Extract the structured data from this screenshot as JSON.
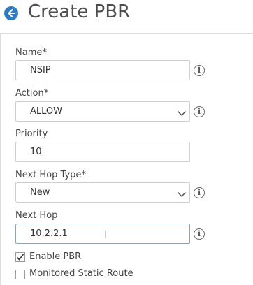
{
  "header": {
    "title": "Create PBR"
  },
  "form": {
    "name": {
      "label": "Name*",
      "value": "NSIP"
    },
    "action": {
      "label": "Action*",
      "value": "ALLOW"
    },
    "priority": {
      "label": "Priority",
      "value": "10"
    },
    "next_hop_type": {
      "label": "Next Hop Type*",
      "value": "New"
    },
    "next_hop": {
      "label": "Next Hop",
      "value": "10.2.2.1"
    },
    "enable_pbr": {
      "label": "Enable PBR",
      "checked": true
    },
    "monitored_static_route": {
      "label": "Monitored Static Route",
      "checked": false
    }
  },
  "icons": {
    "back": "back-arrow-icon",
    "info": "info-icon",
    "chevron": "chevron-down-icon",
    "check": "check-icon"
  },
  "colors": {
    "accent": "#2e7cc3",
    "border": "#cfcfcf"
  }
}
